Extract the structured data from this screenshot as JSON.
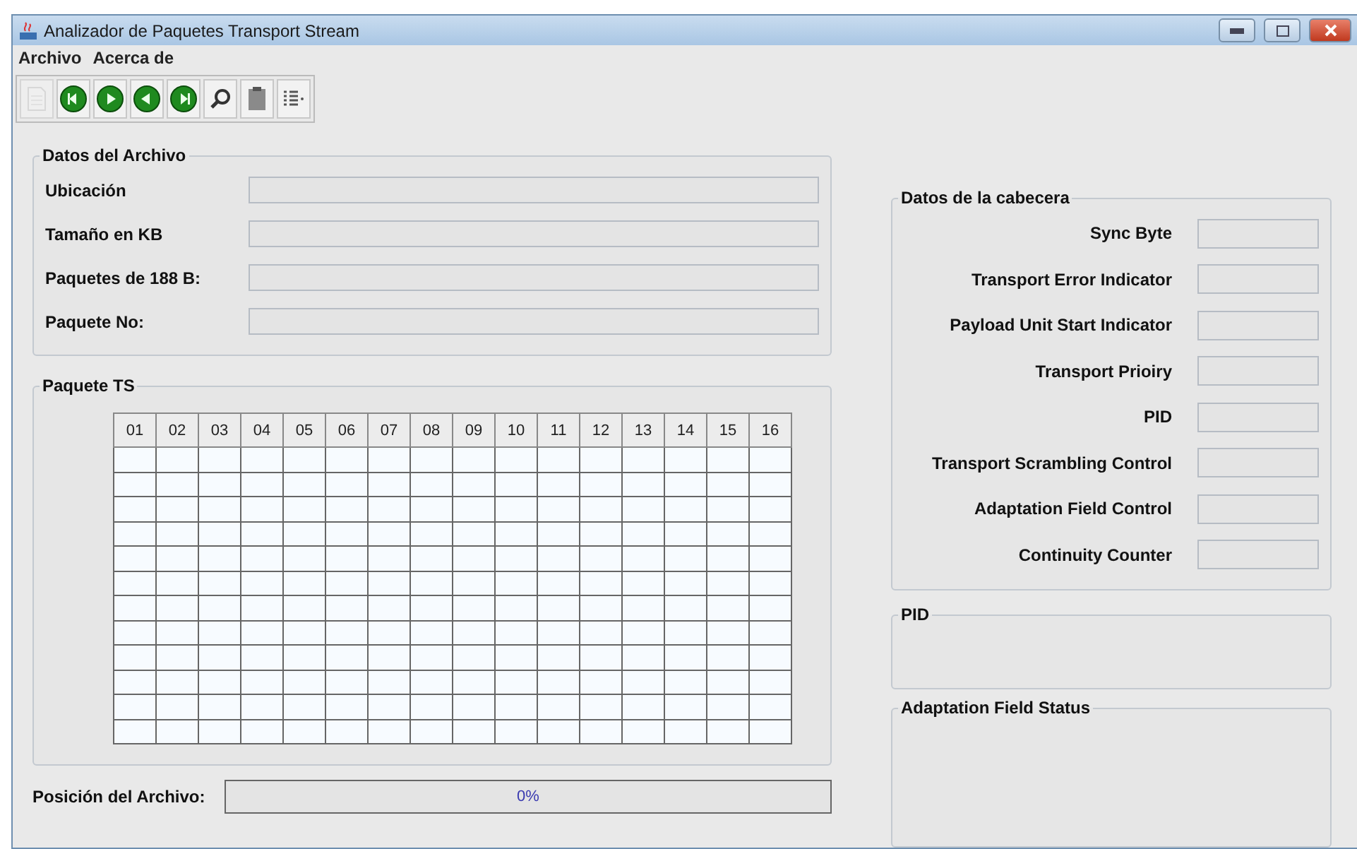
{
  "window": {
    "title": "Analizador de Paquetes Transport Stream"
  },
  "menu": [
    "Archivo",
    "Acerca de"
  ],
  "toolbar": [
    {
      "kind": "document",
      "disabled": true
    },
    {
      "kind": "first",
      "disabled": false
    },
    {
      "kind": "next",
      "disabled": false
    },
    {
      "kind": "previous",
      "disabled": false
    },
    {
      "kind": "last",
      "disabled": false
    },
    {
      "kind": "search",
      "disabled": false
    },
    {
      "kind": "clipboard",
      "disabled": false
    },
    {
      "kind": "list",
      "disabled": false
    }
  ],
  "file_data": {
    "title": "Datos del Archivo",
    "fields": [
      {
        "label": "Ubicación"
      },
      {
        "label": "Tamaño en KB"
      },
      {
        "label": "Paquetes de 188 B:"
      },
      {
        "label": "Paquete No:"
      }
    ]
  },
  "packet": {
    "title": "Paquete TS",
    "columns": [
      "01",
      "02",
      "03",
      "04",
      "05",
      "06",
      "07",
      "08",
      "09",
      "10",
      "11",
      "12",
      "13",
      "14",
      "15",
      "16"
    ]
  },
  "file_position": {
    "label": "Posición del Archivo:",
    "reading": "0%"
  },
  "header_data": {
    "title": "Datos de la cabecera",
    "fields": [
      {
        "label": "Sync Byte"
      },
      {
        "label": "Transport Error Indicator"
      },
      {
        "label": "Payload Unit Start Indicator"
      },
      {
        "label": "Transport Prioiry"
      },
      {
        "label": "PID"
      },
      {
        "label": "Transport Scrambling Control"
      },
      {
        "label": "Adaptation Field Control"
      },
      {
        "label": "Continuity Counter"
      }
    ]
  },
  "pid_panel": {
    "title": "PID"
  },
  "adaptation_panel": {
    "title": "Adaptation Field Status"
  }
}
